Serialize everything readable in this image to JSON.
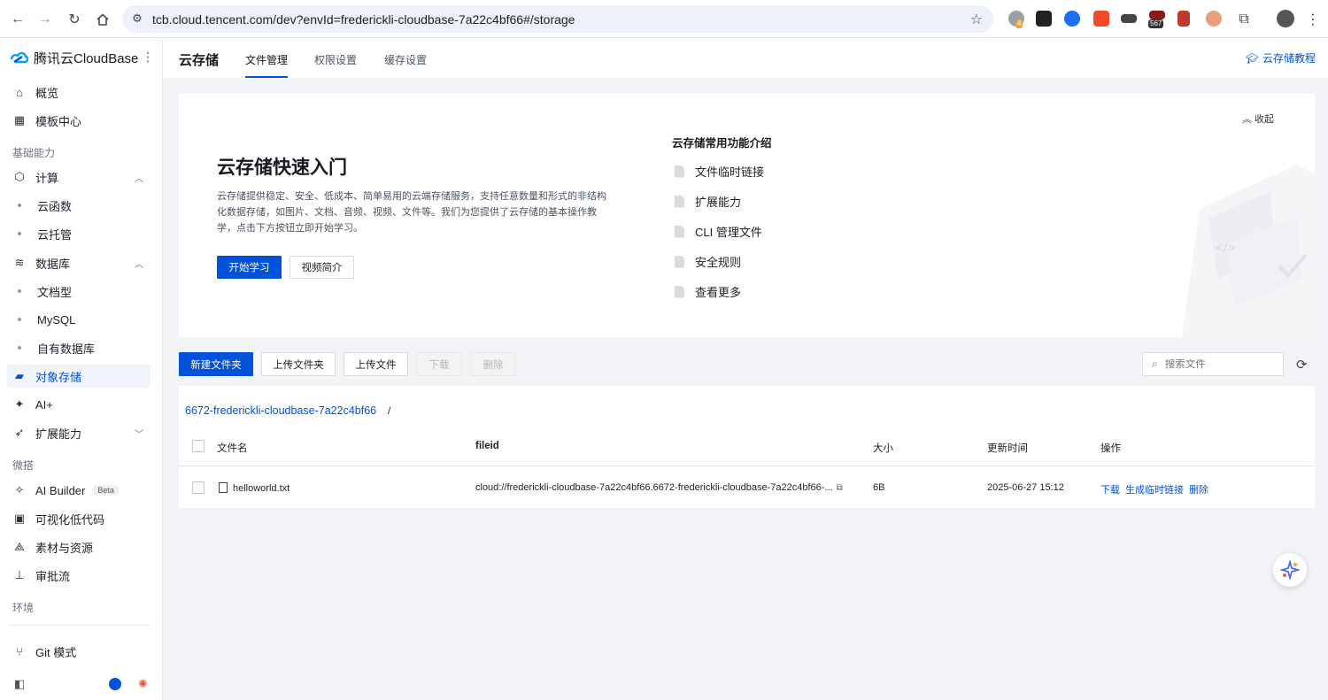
{
  "browser": {
    "url": "tcb.cloud.tencent.com/dev?envId=frederickli-cloudbase-7a22c4bf66#/storage",
    "ext_badge_count": "4",
    "ext_badge_567": "567"
  },
  "sidebar": {
    "brand": "腾讯云CloudBase",
    "items": {
      "overview": "概览",
      "templates": "模板中心",
      "section_basic": "基础能力",
      "compute": "计算",
      "functions": "云函数",
      "hosting": "云托管",
      "database": "数据库",
      "document": "文档型",
      "mysql": "MySQL",
      "own_db": "自有数据库",
      "storage": "对象存储",
      "ai": "AI+",
      "extensions": "扩展能力",
      "section_weida": "微搭",
      "ai_builder": "AI Builder",
      "beta": "Beta",
      "lowcode": "可视化低代码",
      "assets": "素材与资源",
      "approval": "审批流",
      "section_env": "环境",
      "git": "Git 模式"
    }
  },
  "header": {
    "title": "云存储",
    "tabs": [
      "文件管理",
      "权限设置",
      "缓存设置"
    ],
    "tutorial": "云存储教程"
  },
  "intro": {
    "title": "云存储快速入门",
    "description": "云存储提供稳定、安全、低成本、简单易用的云端存储服务，支持任意数量和形式的非结构化数据存储，如图片、文档、音频、视频、文件等。我们为您提供了云存储的基本操作教学，点击下方按钮立即开始学习。",
    "start_button": "开始学习",
    "video_button": "视频简介",
    "collapse": "收起",
    "features_title": "云存储常用功能介绍",
    "features": [
      "文件临时链接",
      "扩展能力",
      "CLI 管理文件",
      "安全规则",
      "查看更多"
    ]
  },
  "toolbar": {
    "new_folder": "新建文件夹",
    "upload_folder": "上传文件夹",
    "upload_file": "上传文件",
    "download": "下载",
    "delete": "删除",
    "search_placeholder": "搜索文件"
  },
  "files": {
    "breadcrumb": "6672-frederickli-cloudbase-7a22c4bf66",
    "breadcrumb_sep": "/",
    "columns": {
      "name": "文件名",
      "fileid": "fileid",
      "size": "大小",
      "updated": "更新时间",
      "actions": "操作"
    },
    "rows": [
      {
        "name": "helloworld.txt",
        "fileid": "cloud://frederickli-cloudbase-7a22c4bf66.6672-frederickli-cloudbase-7a22c4bf66-...",
        "size": "6B",
        "updated": "2025-06-27 15:12",
        "action_download": "下载",
        "action_link": "生成临时链接",
        "action_delete": "删除"
      }
    ]
  },
  "colors": {
    "primary": "#0052d9",
    "background": "#f3f4f7"
  }
}
